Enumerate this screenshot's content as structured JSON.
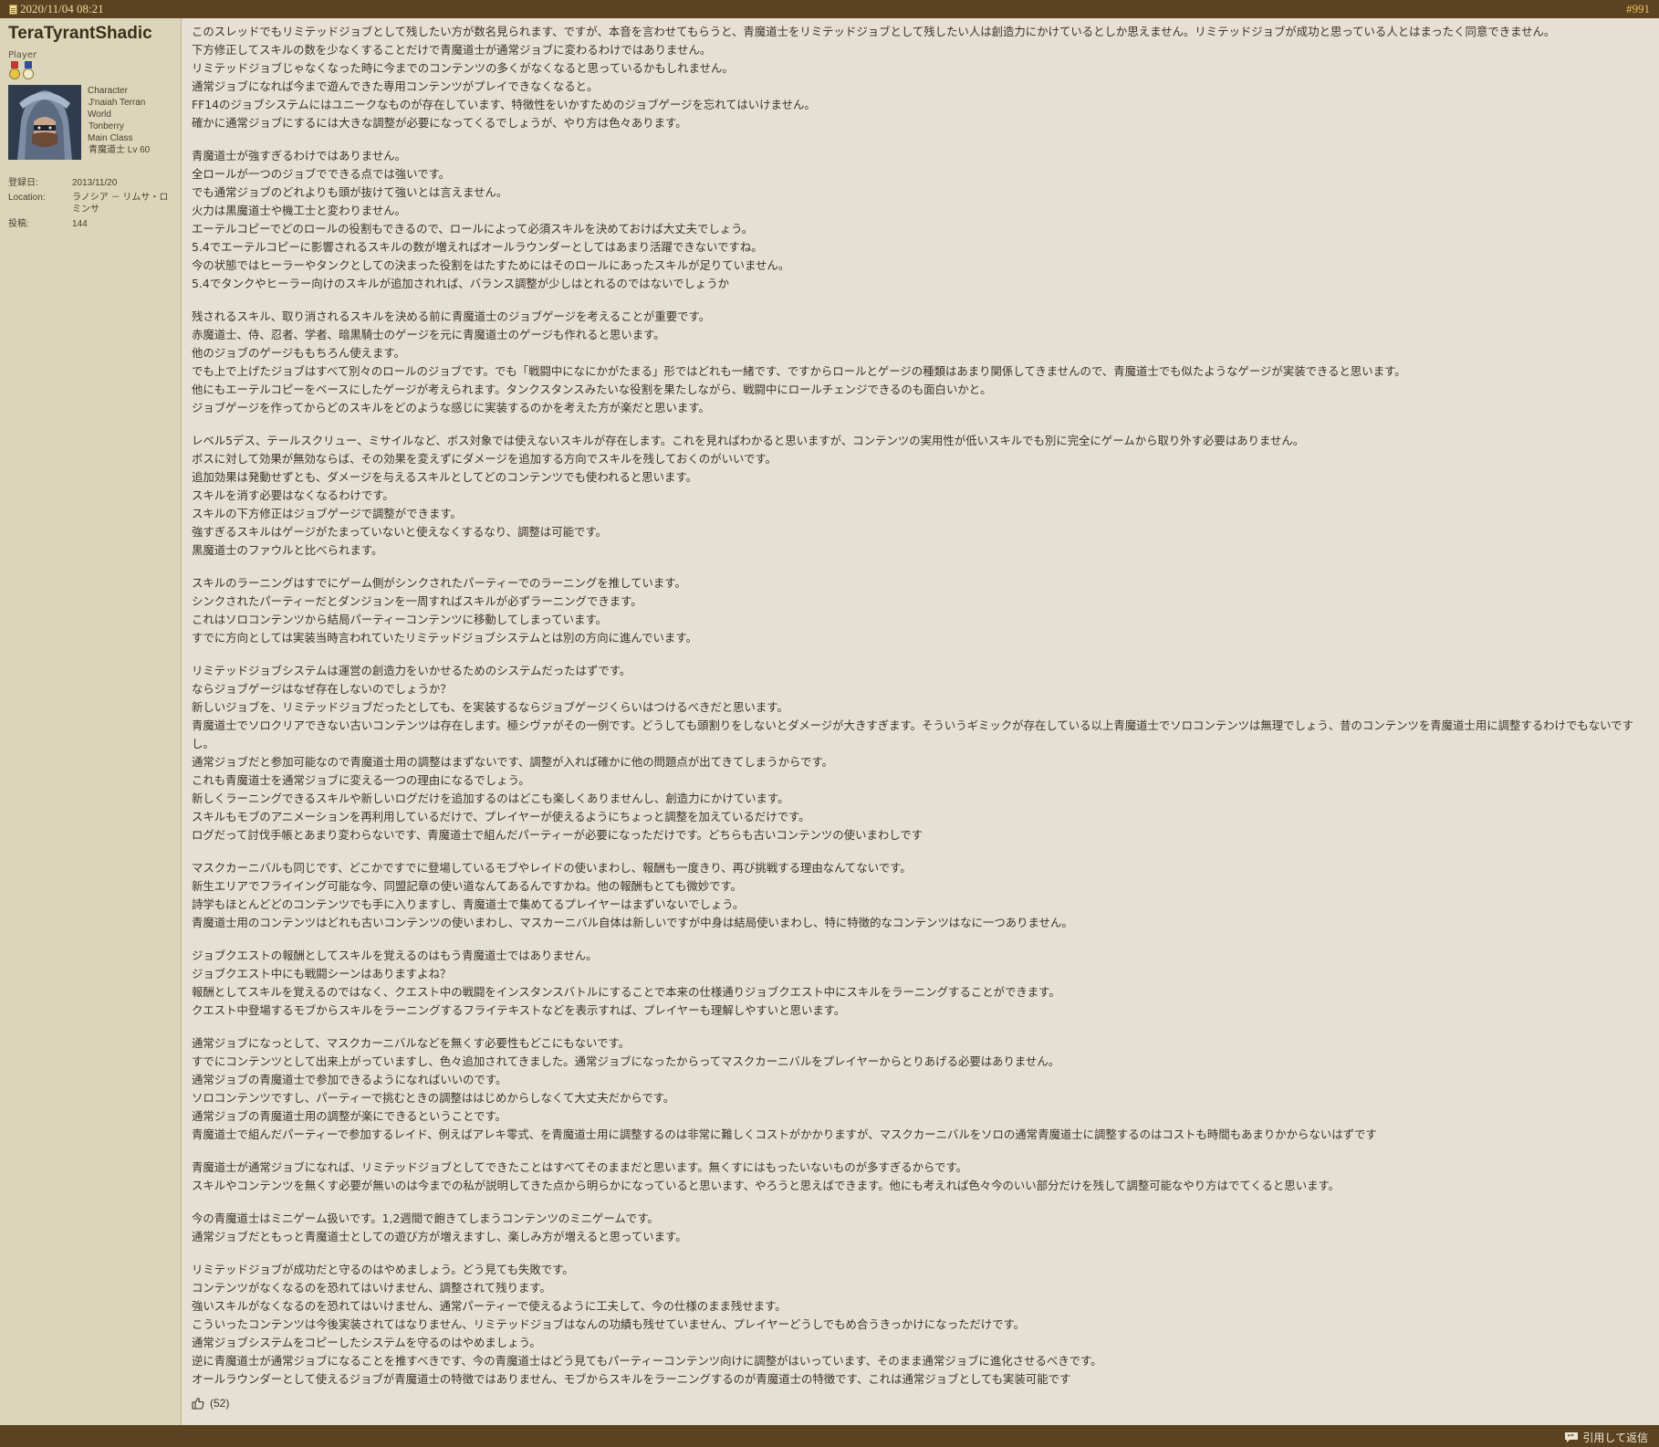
{
  "header": {
    "date": "2020/11/04 08:21",
    "post_number": "#991"
  },
  "user": {
    "name": "TeraTyrantShadic",
    "title": "Player",
    "character_label": "Character",
    "character_name": "J'naiah Terran",
    "world_label": "World",
    "world": "Tonberry",
    "class_label": "Main Class",
    "main_class": "青魔道士 Lv 60",
    "join_label": "登録日:",
    "join_date": "2013/11/20",
    "location_label": "Location:",
    "location": "ラノシア － リムサ・ロミンサ",
    "posts_label": "投稿:",
    "posts": "144",
    "medal_colors": [
      "#c23a2e",
      "#2d4f9e"
    ]
  },
  "message": {
    "paragraphs": [
      [
        "このスレッドでもリミテッドジョブとして残したい方が数名見られます、ですが、本音を言わせてもらうと、青魔道士をリミテッドジョブとして残したい人は創造力にかけているとしか思えません。リミテッドジョブが成功と思っている人とはまったく同意できません。",
        "下方修正してスキルの数を少なくすることだけで青魔道士が通常ジョブに変わるわけではありません。",
        "リミテッドジョブじゃなくなった時に今までのコンテンツの多くがなくなると思っているかもしれません。",
        "通常ジョブになれば今まで遊んできた専用コンテンツがプレイできなくなると。",
        "FF14のジョブシステムにはユニークなものが存在しています、特徴性をいかすためのジョブゲージを忘れてはいけません。",
        "確かに通常ジョブにするには大きな調整が必要になってくるでしょうが、やり方は色々あります。"
      ],
      [
        "青魔道士が強すぎるわけではありません。",
        "全ロールが一つのジョブでできる点では強いです。",
        "でも通常ジョブのどれよりも頭が抜けて強いとは言えません。",
        "火力は黒魔道士や機工士と変わりません。",
        "エーテルコピーでどのロールの役割もできるので、ロールによって必須スキルを決めておけば大丈夫でしょう。",
        "5.4でエーテルコピーに影響されるスキルの数が増えればオールラウンダーとしてはあまり活躍できないですね。",
        "今の状態ではヒーラーやタンクとしての決まった役割をはたすためにはそのロールにあったスキルが足りていません。",
        "5.4でタンクやヒーラー向けのスキルが追加されれば、バランス調整が少しはとれるのではないでしょうか"
      ],
      [
        "残されるスキル、取り消されるスキルを決める前に青魔道士のジョブゲージを考えることが重要です。",
        "赤魔道士、侍、忍者、学者、暗黒騎士のゲージを元に青魔道士のゲージも作れると思います。",
        "他のジョブのゲージももちろん使えます。",
        "でも上で上げたジョブはすべて別々のロールのジョブです。でも「戦闘中になにかがたまる」形ではどれも一緒です、ですからロールとゲージの種類はあまり関係してきませんので、青魔道士でも似たようなゲージが実装できると思います。",
        "他にもエーテルコピーをベースにしたゲージが考えられます。タンクスタンスみたいな役割を果たしながら、戦闘中にロールチェンジできるのも面白いかと。",
        "ジョブゲージを作ってからどのスキルをどのような感じに実装するのかを考えた方が楽だと思います。"
      ],
      [
        "レベル5デス、テールスクリュー、ミサイルなど、ボス対象では使えないスキルが存在します。これを見ればわかると思いますが、コンテンツの実用性が低いスキルでも別に完全にゲームから取り外す必要はありません。",
        "ボスに対して効果が無効ならば、その効果を変えずにダメージを追加する方向でスキルを残しておくのがいいです。",
        "追加効果は発動せずとも、ダメージを与えるスキルとしてどのコンテンツでも使われると思います。",
        "スキルを消す必要はなくなるわけです。",
        "スキルの下方修正はジョブゲージで調整ができます。",
        "強すぎるスキルはゲージがたまっていないと使えなくするなり、調整は可能です。",
        "黒魔道士のファウルと比べられます。"
      ],
      [
        "スキルのラーニングはすでにゲーム側がシンクされたパーティーでのラーニングを推しています。",
        "シンクされたパーティーだとダンジョンを一周すればスキルが必ずラーニングできます。",
        "これはソロコンテンツから結局パーティーコンテンツに移動してしまっています。",
        "すでに方向としては実装当時言われていたリミテッドジョブシステムとは別の方向に進んでいます。"
      ],
      [
        "リミテッドジョブシステムは運営の創造力をいかせるためのシステムだったはずです。",
        "ならジョブゲージはなぜ存在しないのでしょうか？",
        "新しいジョブを、リミテッドジョブだったとしても、を実装するならジョブゲージくらいはつけるべきだと思います。",
        "青魔道士でソロクリアできない古いコンテンツは存在します。極シヴァがその一例です。どうしても頭割りをしないとダメージが大きすぎます。そういうギミックが存在している以上青魔道士でソロコンテンツは無理でしょう、昔のコンテンツを青魔道士用に調整するわけでもないですし。",
        "通常ジョブだと参加可能なので青魔道士用の調整はまずないです、調整が入れば確かに他の問題点が出てきてしまうからです。",
        "これも青魔道士を通常ジョブに変える一つの理由になるでしょう。",
        "新しくラーニングできるスキルや新しいログだけを追加するのはどこも楽しくありませんし、創造力にかけています。",
        "スキルもモブのアニメーションを再利用しているだけで、プレイヤーが使えるようにちょっと調整を加えているだけです。",
        "ログだって討伐手帳とあまり変わらないです、青魔道士で組んだパーティーが必要になっただけです。どちらも古いコンテンツの使いまわしです"
      ],
      [
        "マスクカーニバルも同じです、どこかですでに登場しているモブやレイドの使いまわし、報酬も一度きり、再び挑戦する理由なんてないです。",
        "新生エリアでフライイング可能な今、同盟記章の使い道なんてあるんですかね。他の報酬もとても微妙です。",
        "詩学もほとんどどのコンテンツでも手に入りますし、青魔道士で集めてるプレイヤーはまずいないでしょう。",
        "青魔道士用のコンテンツはどれも古いコンテンツの使いまわし、マスカーニバル自体は新しいですが中身は結局使いまわし、特に特徴的なコンテンツはなに一つありません。"
      ],
      [
        "ジョブクエストの報酬としてスキルを覚えるのはもう青魔道士ではありません。",
        "ジョブクエスト中にも戦闘シーンはありますよね？",
        "報酬としてスキルを覚えるのではなく、クエスト中の戦闘をインスタンスバトルにすることで本来の仕様通りジョブクエスト中にスキルをラーニングすることができます。",
        "クエスト中登場するモブからスキルをラーニングするフライテキストなどを表示すれば、プレイヤーも理解しやすいと思います。"
      ],
      [
        "通常ジョブになっとして、マスクカーニバルなどを無くす必要性もどこにもないです。",
        "すでにコンテンツとして出来上がっていますし、色々追加されてきました。通常ジョブになったからってマスクカーニバルをプレイヤーからとりあげる必要はありません。",
        "通常ジョブの青魔道士で参加できるようになればいいのです。",
        "ソロコンテンツですし、パーティーで挑むときの調整ははじめからしなくて大丈夫だからです。",
        "通常ジョブの青魔道士用の調整が楽にできるということです。",
        "青魔道士で組んだパーティーで参加するレイド、例えばアレキ零式、を青魔道士用に調整するのは非常に難しくコストがかかりますが、マスクカーニバルをソロの通常青魔道士に調整するのはコストも時間もあまりかからないはずです"
      ],
      [
        "青魔道士が通常ジョブになれば、リミテッドジョブとしてできたことはすべてそのままだと思います。無くすにはもったいないものが多すぎるからです。",
        "スキルやコンテンツを無くす必要が無いのは今までの私が説明してきた点から明らかになっていると思います、やろうと思えばできます。他にも考えれば色々今のいい部分だけを残して調整可能なやり方はでてくると思います。"
      ],
      [
        "今の青魔道士はミニゲーム扱いです。1,2週間で飽きてしまうコンテンツのミニゲームです。",
        "通常ジョブだともっと青魔道士としての遊び方が増えますし、楽しみ方が増えると思っています。"
      ],
      [
        "リミテッドジョブが成功だと守るのはやめましょう。どう見ても失敗です。",
        "コンテンツがなくなるのを恐れてはいけません、調整されて残ります。",
        "強いスキルがなくなるのを恐れてはいけません、通常パーティーで使えるように工夫して、今の仕様のまま残せます。",
        "こういったコンテンツは今後実装されてはなりません、リミテッドジョブはなんの功績も残せていません、プレイヤーどうしでもめ合うきっかけになっただけです。",
        "通常ジョブシステムをコピーしたシステムを守るのはやめましょう。",
        "逆に青魔道士が通常ジョブになることを推すべきです、今の青魔道士はどう見てもパーティーコンテンツ向けに調整がはいっています、そのまま通常ジョブに進化させるべきです。",
        "オールラウンダーとして使えるジョブが青魔道士の特徴ではありません、モブからスキルをラーニングするのが青魔道士の特徴です、これは通常ジョブとしても実装可能です"
      ]
    ]
  },
  "likes": {
    "count": "(52)",
    "icon": "thumbs-up-icon"
  },
  "footer": {
    "quote_label": "引用して返信",
    "quote_icon": "quote-bubble-icon"
  },
  "colors": {
    "header_bar": "#5b4322",
    "sidebar_bg": "#dbd6b9",
    "content_bg": "#e6e0d2",
    "post_number": "#f0c060"
  }
}
